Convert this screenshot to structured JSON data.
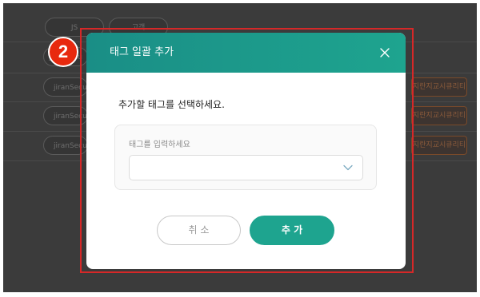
{
  "background": {
    "top_tags": [
      "JS",
      "고객"
    ],
    "row_tag": "jiranSecu",
    "row_tags": [
      "jiranSecu",
      "jiranSecu",
      "jiranSecu",
      "jiranSecu"
    ],
    "row_badge": "지란지교시큐리티"
  },
  "step_badge": "2",
  "modal": {
    "title": "태그 일괄 추가",
    "instruction": "추가할 태그를 선택하세요.",
    "field_label": "태그를 입력하세요",
    "select_value": "",
    "cancel_label": "취 소",
    "add_label": "추 가"
  },
  "colors": {
    "accent": "#1ea48f",
    "header_start": "#1a8e86",
    "highlight": "#d62828",
    "badge": "#e8290e"
  },
  "icons": {
    "close": "close-icon",
    "dropdown": "chevron-down-icon"
  }
}
